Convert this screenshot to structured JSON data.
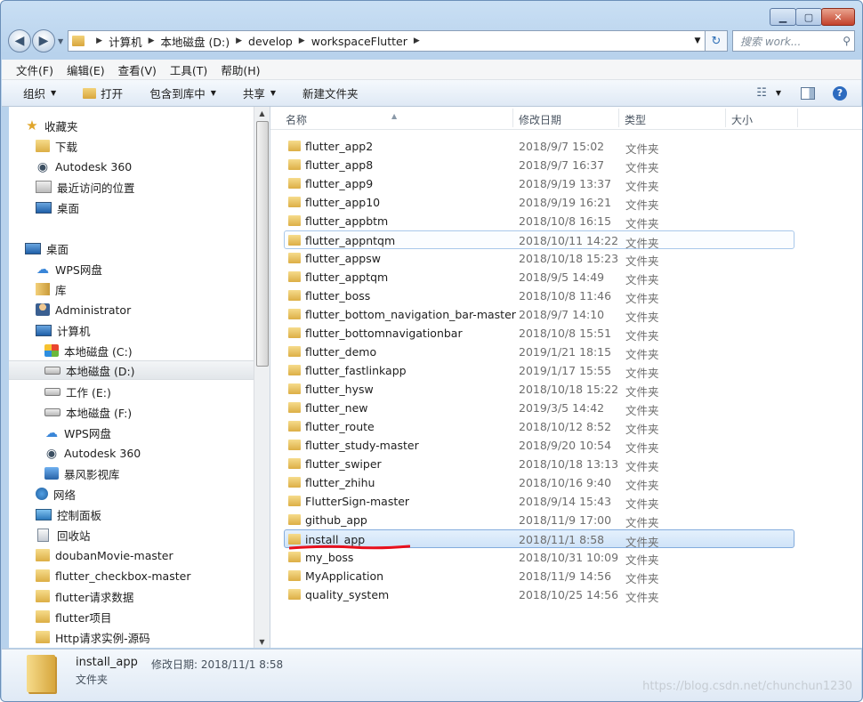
{
  "address": {
    "crumbs": [
      "计算机",
      "本地磁盘 (D:)",
      "develop",
      "workspaceFlutter"
    ],
    "search_placeholder": "搜索 work..."
  },
  "menu": [
    "文件(F)",
    "编辑(E)",
    "查看(V)",
    "工具(T)",
    "帮助(H)"
  ],
  "toolbar": {
    "organize": "组织",
    "open": "打开",
    "include": "包含到库中",
    "share": "共享",
    "new_folder": "新建文件夹"
  },
  "nav": [
    {
      "label": "收藏夹",
      "icon": "star-icon"
    },
    {
      "label": "下载",
      "icon": "download-folder-icon"
    },
    {
      "label": "Autodesk 360",
      "icon": "autodesk-icon"
    },
    {
      "label": "最近访问的位置",
      "icon": "recent-places-icon"
    },
    {
      "label": "桌面",
      "icon": "desktop-icon"
    },
    {
      "label": "桌面",
      "icon": "desktop-icon"
    },
    {
      "label": "WPS网盘",
      "icon": "cloud-icon"
    },
    {
      "label": "库",
      "icon": "library-icon"
    },
    {
      "label": "Administrator",
      "icon": "user-folder-icon"
    },
    {
      "label": "计算机",
      "icon": "computer-icon"
    },
    {
      "label": "本地磁盘 (C:)",
      "icon": "system-drive-icon"
    },
    {
      "label": "本地磁盘 (D:)",
      "icon": "drive-icon"
    },
    {
      "label": "工作 (E:)",
      "icon": "drive-icon"
    },
    {
      "label": "本地磁盘 (F:)",
      "icon": "drive-icon"
    },
    {
      "label": "WPS网盘",
      "icon": "cloud-icon"
    },
    {
      "label": "Autodesk 360",
      "icon": "autodesk-icon"
    },
    {
      "label": "暴风影视库",
      "icon": "movie-library-icon"
    },
    {
      "label": "网络",
      "icon": "network-icon"
    },
    {
      "label": "控制面板",
      "icon": "control-panel-icon"
    },
    {
      "label": "回收站",
      "icon": "recycle-bin-icon"
    },
    {
      "label": "doubanMovie-master",
      "icon": "folder-icon"
    },
    {
      "label": "flutter_checkbox-master",
      "icon": "folder-icon"
    },
    {
      "label": "flutter请求数据",
      "icon": "folder-icon"
    },
    {
      "label": "flutter项目",
      "icon": "folder-icon"
    },
    {
      "label": "Http请求实例-源码",
      "icon": "folder-icon"
    }
  ],
  "columns": {
    "name": "名称",
    "date": "修改日期",
    "type": "类型",
    "size": "大小"
  },
  "files": [
    {
      "name": "flutter_app2",
      "date": "2018/9/7 15:02",
      "type": "文件夹"
    },
    {
      "name": "flutter_app8",
      "date": "2018/9/7 16:37",
      "type": "文件夹"
    },
    {
      "name": "flutter_app9",
      "date": "2018/9/19 13:37",
      "type": "文件夹"
    },
    {
      "name": "flutter_app10",
      "date": "2018/9/19 16:21",
      "type": "文件夹"
    },
    {
      "name": "flutter_appbtm",
      "date": "2018/10/8 16:15",
      "type": "文件夹"
    },
    {
      "name": "flutter_appntqm",
      "date": "2018/10/11 14:22",
      "type": "文件夹"
    },
    {
      "name": "flutter_appsw",
      "date": "2018/10/18 15:23",
      "type": "文件夹"
    },
    {
      "name": "flutter_apptqm",
      "date": "2018/9/5 14:49",
      "type": "文件夹"
    },
    {
      "name": "flutter_boss",
      "date": "2018/10/8 11:46",
      "type": "文件夹"
    },
    {
      "name": "flutter_bottom_navigation_bar-master",
      "date": "2018/9/7 14:10",
      "type": "文件夹"
    },
    {
      "name": "flutter_bottomnavigationbar",
      "date": "2018/10/8 15:51",
      "type": "文件夹"
    },
    {
      "name": "flutter_demo",
      "date": "2019/1/21 18:15",
      "type": "文件夹"
    },
    {
      "name": "flutter_fastlinkapp",
      "date": "2019/1/17 15:55",
      "type": "文件夹"
    },
    {
      "name": "flutter_hysw",
      "date": "2018/10/18 15:22",
      "type": "文件夹"
    },
    {
      "name": "flutter_new",
      "date": "2019/3/5 14:42",
      "type": "文件夹"
    },
    {
      "name": "flutter_route",
      "date": "2018/10/12 8:52",
      "type": "文件夹"
    },
    {
      "name": "flutter_study-master",
      "date": "2018/9/20 10:54",
      "type": "文件夹"
    },
    {
      "name": "flutter_swiper",
      "date": "2018/10/18 13:13",
      "type": "文件夹"
    },
    {
      "name": "flutter_zhihu",
      "date": "2018/10/16 9:40",
      "type": "文件夹"
    },
    {
      "name": "FlutterSign-master",
      "date": "2018/9/14 15:43",
      "type": "文件夹"
    },
    {
      "name": "github_app",
      "date": "2018/11/9 17:00",
      "type": "文件夹"
    },
    {
      "name": "install_app",
      "date": "2018/11/1 8:58",
      "type": "文件夹"
    },
    {
      "name": "my_boss",
      "date": "2018/10/31 10:09",
      "type": "文件夹"
    },
    {
      "name": "MyApplication",
      "date": "2018/11/9 14:56",
      "type": "文件夹"
    },
    {
      "name": "quality_system",
      "date": "2018/10/25 14:56",
      "type": "文件夹"
    }
  ],
  "details": {
    "name": "install_app",
    "meta": "修改日期: 2018/11/1 8:58",
    "type": "文件夹"
  },
  "watermark": "https://blog.csdn.net/chunchun1230",
  "colors": {
    "selection": "#cfe3f8",
    "annotation": "#e8101c"
  }
}
